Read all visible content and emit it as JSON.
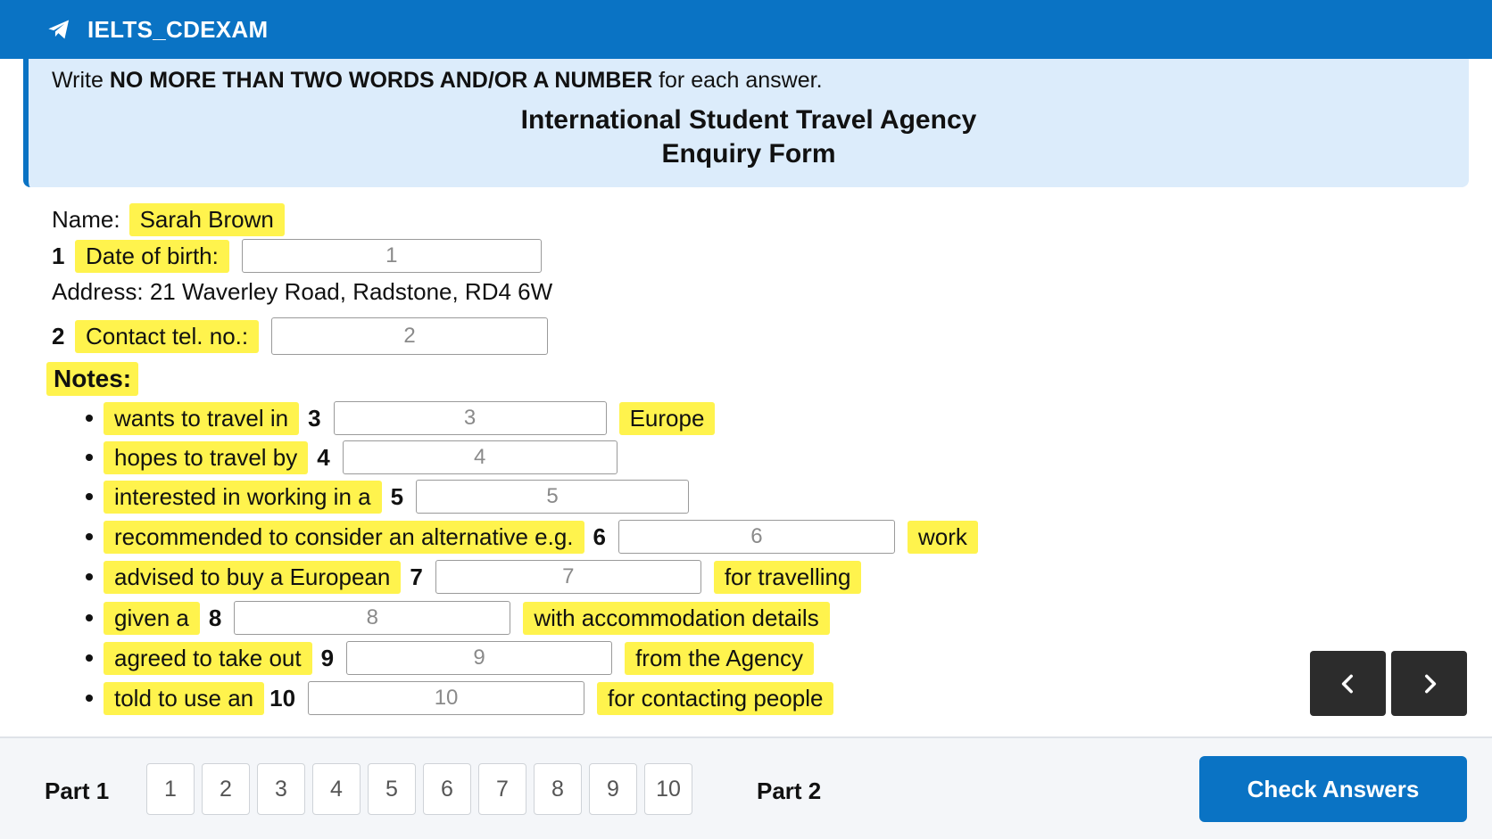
{
  "app": {
    "title": "IELTS_CDEXAM"
  },
  "instructions": {
    "prefix": "Write",
    "bold": "NO MORE THAN TWO WORDS AND/OR A NUMBER",
    "suffix": "for each answer.",
    "title_line1": "International Student Travel Agency",
    "title_line2": "Enquiry Form"
  },
  "form": {
    "name_label": "Name:",
    "name_value": "Sarah Brown",
    "address": "Address: 21 Waverley Road, Radstone, RD4 6W",
    "notes_label": "Notes:",
    "q1": {
      "num": "1",
      "label": "Date of birth:",
      "placeholder": "1"
    },
    "q2": {
      "num": "2",
      "label": "Contact tel. no.:",
      "placeholder": "2"
    },
    "q3": {
      "num": "3",
      "before": "wants to travel in",
      "placeholder": "3",
      "after": "Europe"
    },
    "q4": {
      "num": "4",
      "before": "hopes to travel by",
      "placeholder": "4",
      "after": ""
    },
    "q5": {
      "num": "5",
      "before": "interested in working in a",
      "placeholder": "5",
      "after": ""
    },
    "q6": {
      "num": "6",
      "before": "recommended to consider an alternative e.g.",
      "placeholder": "6",
      "after": "work"
    },
    "q7": {
      "num": "7",
      "before": "advised to buy a European",
      "placeholder": "7",
      "after": "for travelling"
    },
    "q8": {
      "num": "8",
      "before": "given a",
      "placeholder": "8",
      "after": "with accommodation details"
    },
    "q9": {
      "num": "9",
      "before": "agreed to take out",
      "placeholder": "9",
      "after": "from the Agency"
    },
    "q10": {
      "num": "10",
      "before": "told to use an",
      "placeholder": "10",
      "after": "for contacting people"
    }
  },
  "nav": {
    "prev_icon": "chevron-left-icon",
    "next_icon": "chevron-right-icon"
  },
  "footer": {
    "part1": "Part 1",
    "part2": "Part 2",
    "questions": [
      "1",
      "2",
      "3",
      "4",
      "5",
      "6",
      "7",
      "8",
      "9",
      "10"
    ],
    "check_label": "Check Answers"
  },
  "colors": {
    "brand": "#0a73c4",
    "highlight": "#fff34d",
    "instruction_bg": "#dcecfb"
  }
}
